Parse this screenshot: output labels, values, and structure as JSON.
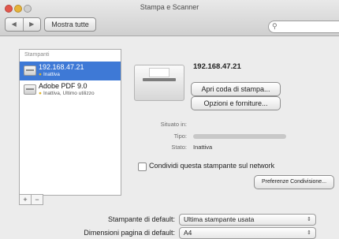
{
  "window": {
    "title": "Stampa e Scanner"
  },
  "toolbar": {
    "back": "◀",
    "forward": "▶",
    "show_all": "Mostra tutte",
    "search_placeholder": ""
  },
  "printers": {
    "header": "Stampanti",
    "items": [
      {
        "name": "192.168.47.21",
        "status": "Inattiva"
      },
      {
        "name": "Adobe PDF 9.0",
        "status": "Inattiva, Ultimo utilizzo"
      }
    ],
    "add": "+",
    "remove": "−"
  },
  "detail": {
    "name": "192.168.47.21",
    "open_queue": "Apri coda di stampa...",
    "options": "Opzioni e forniture...",
    "location_label": "Situato in:",
    "type_label": "Tipo:",
    "status_label": "Stato:",
    "status_value": "Inattiva",
    "share_label": "Condividi questa stampante sul network",
    "share_prefs": "Preferenze Condivisione..."
  },
  "defaults": {
    "printer_label": "Stampante di default:",
    "printer_value": "Ultima stampante usata",
    "paper_label": "Dimensioni pagina di default:",
    "paper_value": "A4"
  }
}
